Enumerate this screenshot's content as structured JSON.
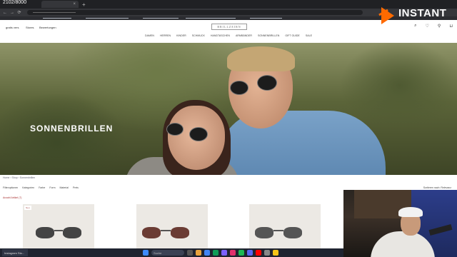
{
  "browser": {
    "counter": "2102/8000",
    "tab_title": "",
    "new_tab": "+",
    "nav": {
      "back": "←",
      "forward": "→",
      "reload": "⟳"
    }
  },
  "site": {
    "top_left": [
      "gratis vers",
      "Stores",
      "Bewertungen"
    ],
    "logo_text": "BRILLZEIRN",
    "icons": [
      "search-icon",
      "heart-icon",
      "user-icon",
      "cart-icon"
    ],
    "categories": [
      "Damen",
      "Herren",
      "Kinder",
      "Schmuck",
      "Handtaschen",
      "Armbänder",
      "Sonnenbrillen",
      "Gift Guide",
      "Sale"
    ],
    "hero_title": "SONNENBRILLEN",
    "breadcrumb": [
      "Home",
      "Shop",
      "Sonnenbrillen"
    ],
    "filters": [
      "Filteroptionen",
      "Kategorien",
      "Farbe",
      "Form",
      "Material",
      "Preis"
    ],
    "sort": "Sortieren nach: Relevanz",
    "result_count": "Anzahl Artikel (7)",
    "products": [
      {
        "badge": "Neu"
      },
      {
        "badge": ""
      },
      {
        "badge": ""
      }
    ]
  },
  "taskbar": {
    "app_label": "Instagram Sto...",
    "search_placeholder": "Suche",
    "tray": "^"
  },
  "overlay": {
    "brand": "INSTANT"
  },
  "colors": {
    "accent": "#ff6a00",
    "shirt": "#6f97c0",
    "hero_dark": "#3e4526"
  }
}
